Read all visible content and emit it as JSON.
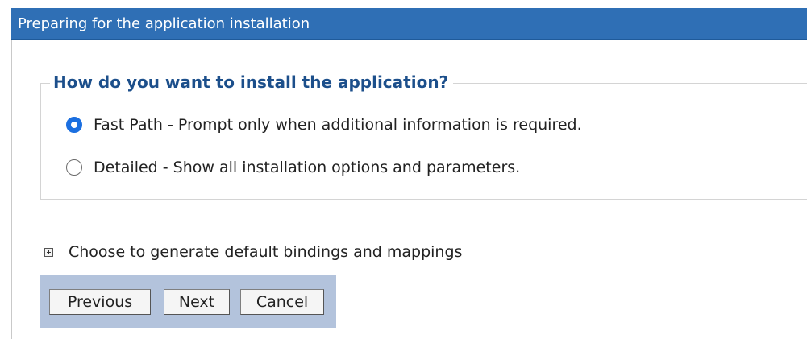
{
  "header": {
    "title": "Preparing for the application installation"
  },
  "install_method": {
    "legend": "How do you want to install the application?",
    "options": [
      {
        "label": "Fast Path - Prompt only when additional information is required.",
        "selected": true
      },
      {
        "label": "Detailed - Show all installation options and parameters.",
        "selected": false
      }
    ]
  },
  "bindings_section": {
    "label": "Choose to generate default bindings and mappings",
    "expanded": false
  },
  "buttons": {
    "previous": "Previous",
    "next": "Next",
    "cancel": "Cancel"
  },
  "colors": {
    "title_bar": "#2f6fb5",
    "legend_text": "#1c4f8b",
    "radio_selected": "#1b6fe0",
    "button_bar": "#b3c3dc"
  },
  "icons": {
    "expander": "plus-box-icon"
  }
}
